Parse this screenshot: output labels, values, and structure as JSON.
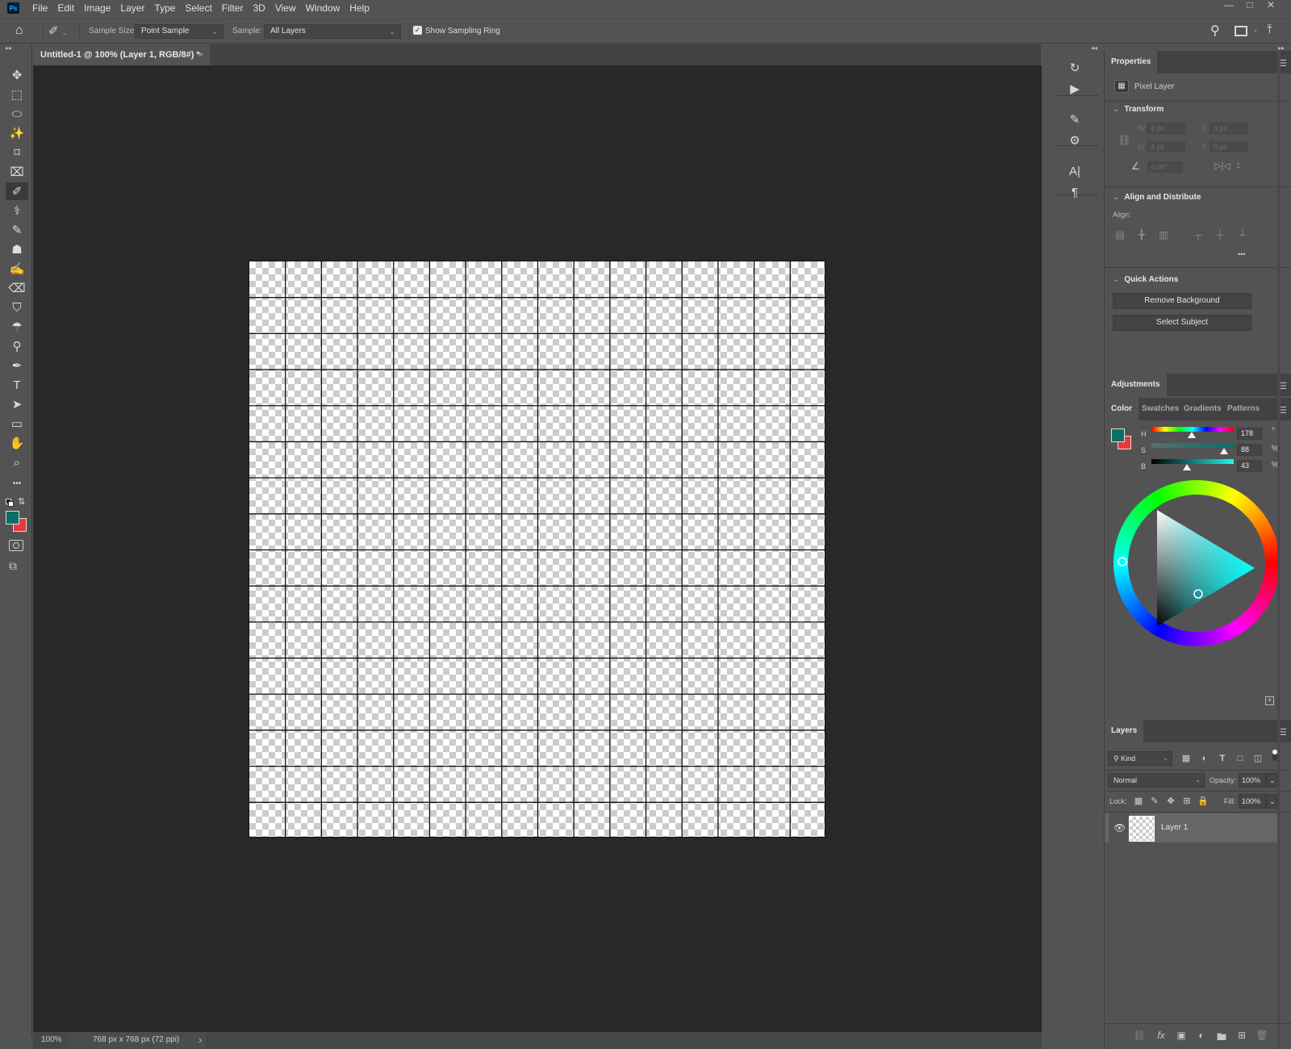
{
  "app": {
    "logo": "Ps"
  },
  "menu": [
    "File",
    "Edit",
    "Image",
    "Layer",
    "Type",
    "Select",
    "Filter",
    "3D",
    "View",
    "Window",
    "Help"
  ],
  "window_controls": {
    "minimize": "—",
    "maximize": "□",
    "close": "✕"
  },
  "options": {
    "sample_size_label": "Sample Size:",
    "sample_size_value": "Point Sample",
    "sample_label": "Sample:",
    "sample_value": "All Layers",
    "show_sampling_ring_label": "Show Sampling Ring",
    "show_sampling_ring_checked": true
  },
  "document": {
    "tab_title": "Untitled-1 @ 100% (Layer 1, RGB/8#) *",
    "close": "×",
    "grid_cells": 16
  },
  "status": {
    "zoom": "100%",
    "doc_info": "768 px x 768 px (72 ppi)",
    "arrow": "›"
  },
  "tools": [
    {
      "name": "move-tool",
      "glyph": "✥"
    },
    {
      "name": "marquee-tool",
      "glyph": "⬚"
    },
    {
      "name": "lasso-tool",
      "glyph": "⬭"
    },
    {
      "name": "magic-wand-tool",
      "glyph": "✨"
    },
    {
      "name": "crop-tool",
      "glyph": "⌑"
    },
    {
      "name": "frame-tool",
      "glyph": "⌧"
    },
    {
      "name": "eyedropper-tool",
      "glyph": "✐",
      "active": true
    },
    {
      "name": "healing-brush-tool",
      "glyph": "⚕"
    },
    {
      "name": "brush-tool",
      "glyph": "✎"
    },
    {
      "name": "clone-stamp-tool",
      "glyph": "☗"
    },
    {
      "name": "history-brush-tool",
      "glyph": "✍"
    },
    {
      "name": "eraser-tool",
      "glyph": "⌫"
    },
    {
      "name": "paint-bucket-tool",
      "glyph": "⛉"
    },
    {
      "name": "blur-tool",
      "glyph": "☂"
    },
    {
      "name": "dodge-tool",
      "glyph": "⚲"
    },
    {
      "name": "pen-tool",
      "glyph": "✒"
    },
    {
      "name": "type-tool",
      "glyph": "T"
    },
    {
      "name": "path-selection-tool",
      "glyph": "➤"
    },
    {
      "name": "rectangle-tool",
      "glyph": "▭"
    },
    {
      "name": "hand-tool",
      "glyph": "✋"
    },
    {
      "name": "zoom-tool",
      "glyph": "⌕"
    },
    {
      "name": "more-tools",
      "glyph": "•••"
    }
  ],
  "colors": {
    "foreground": "#0b6e6a",
    "background": "#e8383d",
    "accent": "#31a8ff"
  },
  "dock": [
    "history-icon",
    "actions-icon",
    "brush-settings-icon",
    "adjustments-sliders-icon",
    "character-icon",
    "paragraph-icon"
  ],
  "properties": {
    "tab": "Properties",
    "layer_type": "Pixel Layer",
    "transform": {
      "title": "Transform",
      "w_label": "W",
      "w_value": "4 px",
      "h_label": "H",
      "h_value": "4 px",
      "x_label": "X",
      "x_value": "0 px",
      "y_label": "Y",
      "y_value": "0 px",
      "angle_value": "0.00°"
    },
    "align": {
      "title": "Align and Distribute",
      "label": "Align:",
      "more": "•••"
    },
    "quick_actions": {
      "title": "Quick Actions",
      "remove_background": "Remove Background",
      "select_subject": "Select Subject"
    }
  },
  "adjustments": {
    "tab": "Adjustments"
  },
  "color_panel": {
    "tabs": [
      "Color",
      "Swatches",
      "Gradients",
      "Patterns"
    ],
    "active_tab": "Color",
    "h_label": "H",
    "h_value": "178",
    "h_unit": "°",
    "s_label": "S",
    "s_value": "88",
    "s_unit": "%",
    "b_label": "B",
    "b_value": "43",
    "b_unit": "%",
    "hue": 178,
    "saturation": 88,
    "brightness": 43
  },
  "layers": {
    "tab": "Layers",
    "filter_kind": "Kind",
    "blend_mode": "Normal",
    "opacity_label": "Opacity:",
    "opacity_value": "100%",
    "lock_label": "Lock:",
    "fill_label": "Fill:",
    "fill_value": "100%",
    "items": [
      {
        "name": "Layer 1",
        "visible": true,
        "selected": true
      }
    ]
  }
}
